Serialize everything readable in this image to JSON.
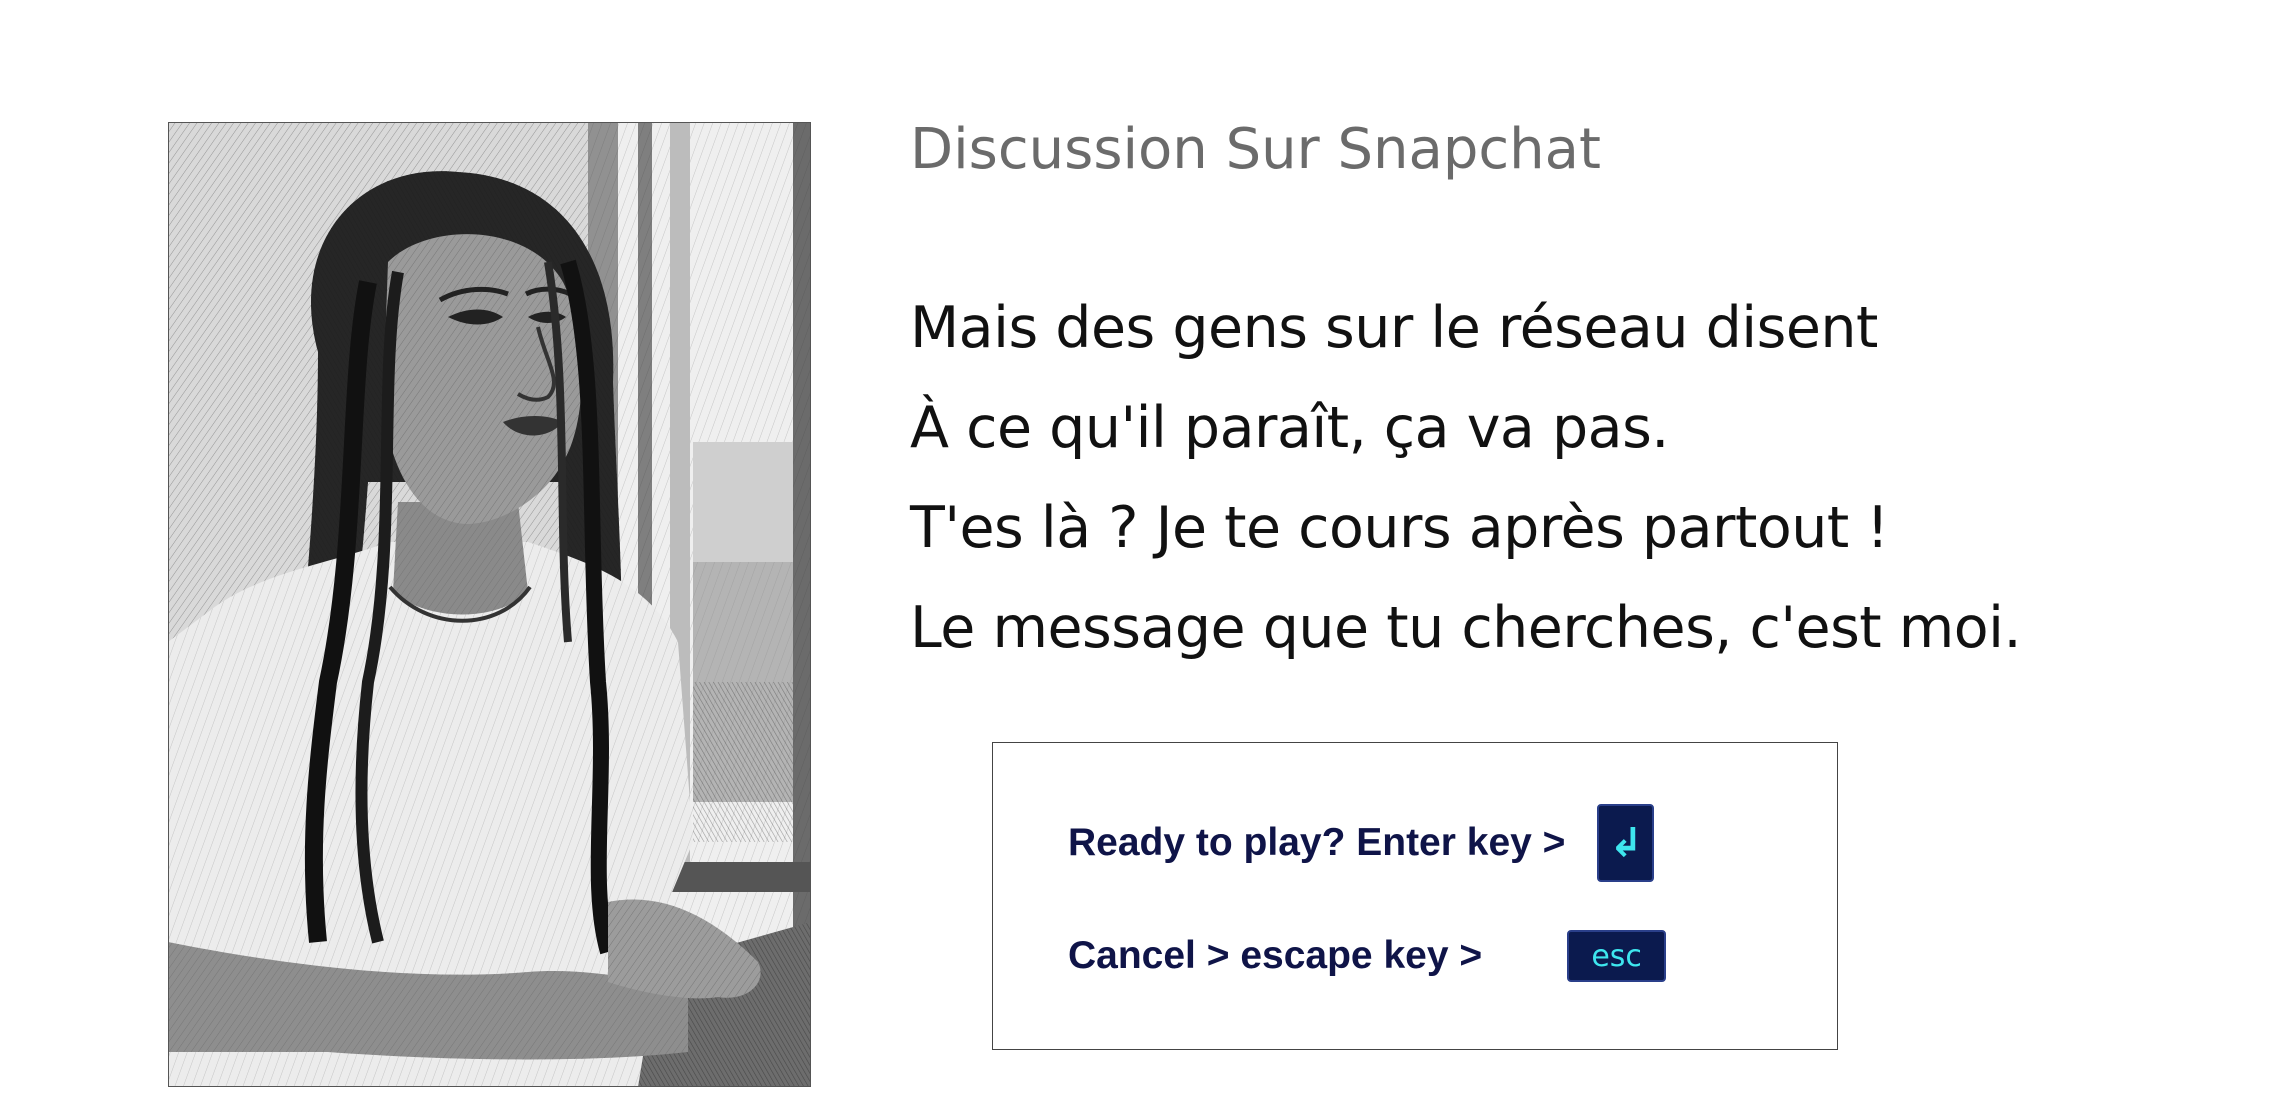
{
  "title": "Discussion Sur Snapchat",
  "lyrics": [
    "Mais des gens sur le réseau disent",
    "À ce qu'il paraît, ça va pas.",
    "T'es là ? Je te cours après partout !",
    "Le message que tu cherches, c'est moi."
  ],
  "prompt": {
    "play_label": "Ready to play?  Enter key  >",
    "enter_key_glyph": "↲",
    "cancel_label": "Cancel > escape key  >",
    "esc_key_label": "esc"
  },
  "image": {
    "subject": "pencil-sketch-portrait-of-woman-by-window"
  },
  "colors": {
    "title": "#6b6b6b",
    "lyrics": "#111111",
    "prompt_text": "#0f1448",
    "keycap_bg": "#0b1a4e",
    "keycap_text": "#3ee6ee"
  }
}
